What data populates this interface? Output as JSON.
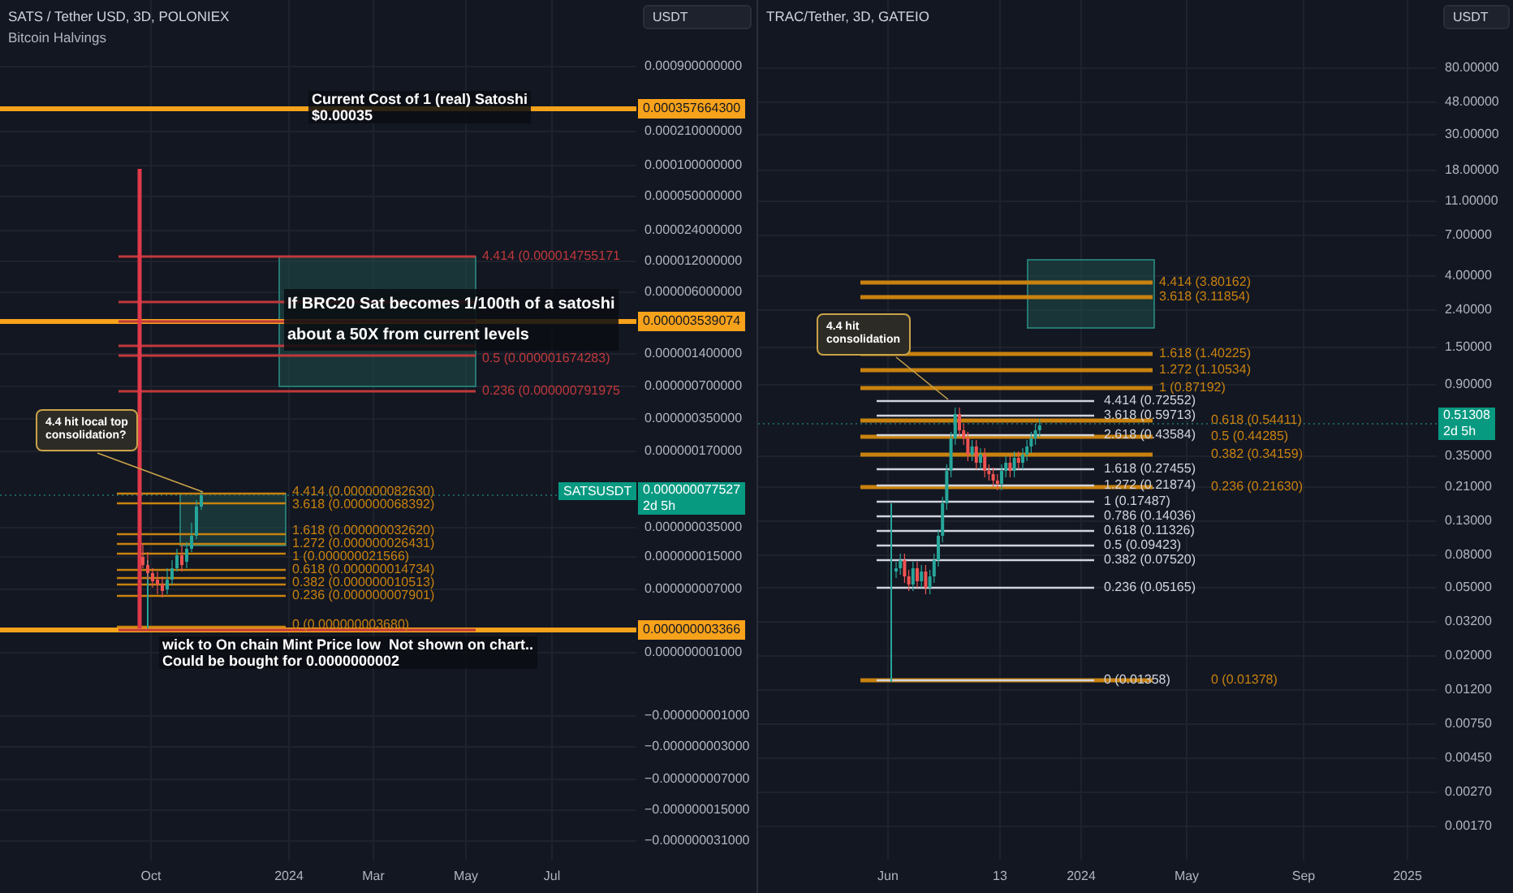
{
  "left_chart": {
    "title": "SATS / Tether USD, 3D, POLONIEX",
    "indicator": "Bitcoin Halvings",
    "currency_button": "USDT",
    "notes": [
      {
        "kind": "label",
        "lines": [
          "Current Cost of 1 (real) Satoshi",
          "$0.00035"
        ]
      },
      {
        "kind": "label",
        "lines": [
          "If BRC20 Sat becomes 1/100th of a satoshi",
          "about a 50X from current levels"
        ]
      },
      {
        "kind": "callout",
        "lines": [
          "4.4 hit local top",
          "consolidation?"
        ]
      },
      {
        "kind": "label",
        "lines": [
          "wick to On chain Mint Price low  Not shown on chart..",
          "Could be bought for 0.0000000002"
        ]
      }
    ],
    "fib_sets": [
      {
        "color": "#c0393b",
        "labels": [
          "4.414 (0.000014755171",
          "0.5 (0.000001674283)",
          "0.236 (0.000000791975"
        ]
      },
      {
        "color": "#c8820f",
        "labels": [
          "4.414 (0.000000082630)",
          "3.618 (0.000000068392)",
          "1.618 (0.000000032620)",
          "1.272 (0.000000026431)",
          "1 (0.000000021566)",
          "0.618 (0.000000014734)",
          "0.382 (0.000000010513)",
          "0.236 (0.000000007901)",
          "0 (0.000000003680)"
        ]
      }
    ],
    "price_axis": [
      "0.000900000000",
      "0.000210000000",
      "0.000100000000",
      "0.000050000000",
      "0.000024000000",
      "0.000012000000",
      "0.000006000000",
      "0.000001400000",
      "0.000000700000",
      "0.000000350000",
      "0.000000170000",
      "0.000000035000",
      "0.000000015000",
      "0.000000007000",
      "0.000000001000",
      "−0.000000001000",
      "−0.000000003000",
      "−0.000000007000",
      "−0.000000015000",
      "−0.000000031000"
    ],
    "price_badges": [
      "0.000357664300",
      "0.000003539074",
      "0.000000003366"
    ],
    "last_price": {
      "symbol": "SATSUSDT",
      "price": "0.000000077527",
      "countdown": "2d 5h"
    },
    "time_axis": [
      "Oct",
      "2024",
      "Mar",
      "May",
      "Jul"
    ]
  },
  "right_chart": {
    "title": "TRAC/Tether, 3D, GATEIO",
    "currency_button": "USDT",
    "notes": [
      {
        "kind": "callout",
        "lines": [
          "4.4 hit",
          "consolidation"
        ]
      }
    ],
    "fib_sets": [
      {
        "color": "#c8820f",
        "labels": [
          "4.414 (3.80162)",
          "3.618 (3.11854)",
          "1.618 (1.40225)",
          "1.272 (1.10534)",
          "1 (0.87192)",
          "0.618 (0.54411)",
          "0.5 (0.44285)",
          "0.382 (0.34159)",
          "0.236 (0.21630)",
          "0 (0.01378)"
        ]
      },
      {
        "color": "#d1d4dc",
        "labels": [
          "4.414 (0.72552)",
          "3.618 (0.59713)",
          "2.618 (0.43584)",
          "1.618 (0.27455)",
          "1.272 (0.21874)",
          "1 (0.17487)",
          "0.786 (0.14036)",
          "0.618 (0.11326)",
          "0.5 (0.09423)",
          "0.382 (0.07520)",
          "0.236 (0.05165)",
          "0 (0.01358)"
        ]
      }
    ],
    "price_axis": [
      "80.00000",
      "48.00000",
      "30.00000",
      "18.00000",
      "11.00000",
      "7.00000",
      "4.00000",
      "2.40000",
      "1.50000",
      "0.90000",
      "0.35000",
      "0.21000",
      "0.13000",
      "0.08000",
      "0.05000",
      "0.03200",
      "0.02000",
      "0.01200",
      "0.00750",
      "0.00450",
      "0.00270",
      "0.00170"
    ],
    "last_price": {
      "price": "0.51308",
      "countdown": "2d 5h"
    },
    "time_axis": [
      "Jun",
      "13",
      "2024",
      "May",
      "Sep",
      "2025"
    ]
  }
}
